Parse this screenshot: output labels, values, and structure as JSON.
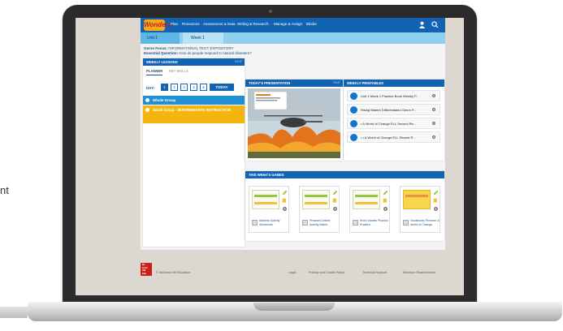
{
  "page_side_text": "nt",
  "nav": {
    "logo": "Wonders",
    "items": [
      "Plan",
      "Resources",
      "Assessment & Data",
      "Writing & Research",
      "Manage & Assign",
      "Binder"
    ]
  },
  "breadcrumb": {
    "unit": "Unit 1",
    "week": "Week 1"
  },
  "genre": {
    "focus_label": "Genre Focus:",
    "focus_value": "INFORMATIONAL TEXT: EXPOSITORY",
    "question_label": "Essential Question:",
    "question_value": "How do people respond to natural disasters?"
  },
  "weekly_lessons": {
    "title": "WEEKLY LESSONS",
    "edit": "EDIT",
    "tabs": [
      "PLANNER",
      "KEY SKILLS"
    ],
    "day_label": "DAY:",
    "days": [
      "1",
      "2",
      "3",
      "4",
      "5"
    ],
    "today": "TODAY",
    "whole_group": "Whole Group",
    "small_group": "Small Group - INTERMEDIATE INSTRUCTION"
  },
  "presentation": {
    "title": "TODAY'S PRESENTATION",
    "edit": "EDIT"
  },
  "printables": {
    "title": "WEEKLY PRINTABLES",
    "items": [
      "Unit 1 Week 1 Practice Book Weekly P...",
      "Rising Waters Differentiated Genre P...",
      "• A World of Change ELL Second Re...",
      "• • A World of Change ELL Shared R..."
    ]
  },
  "games": {
    "title": "THIS WEEK'S GAMES",
    "items": [
      "Adverse Activity Sentences",
      "Precise/Context Activity Match",
      "Short Vowels Phonics Practice",
      "Vocabulary Preview: A World of Change"
    ]
  },
  "footer": {
    "logo_lines": [
      "Mc",
      "Graw",
      "Hill",
      "Edu"
    ],
    "copyright": "© McGraw-Hill Education",
    "links": [
      "Legal",
      "Privacy and Cookie Policy",
      "Technical Support",
      "Minimum Requirements"
    ]
  },
  "colors": {
    "brand_blue": "#1363b3",
    "group_blue": "#1f8fd6",
    "group_yellow": "#f5b50f",
    "accent_green": "#93c643"
  }
}
